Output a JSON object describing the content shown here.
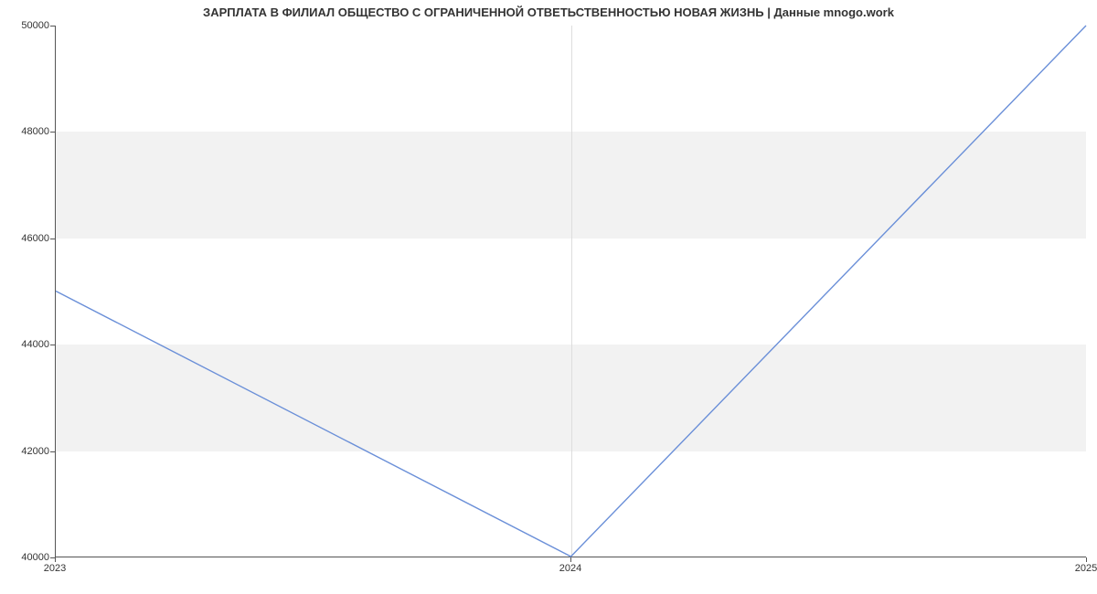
{
  "chart_data": {
    "type": "line",
    "title": "ЗАРПЛАТА В ФИЛИАЛ ОБЩЕСТВО С ОГРАНИЧЕННОЙ ОТВЕТЬСТВЕННОСТЬЮ НОВАЯ ЖИЗНЬ | Данные mnogo.work",
    "xlabel": "",
    "ylabel": "",
    "x_ticks": [
      "2023",
      "2024",
      "2025"
    ],
    "y_ticks": [
      40000,
      42000,
      44000,
      46000,
      48000,
      50000
    ],
    "ylim": [
      40000,
      50000
    ],
    "xlim": [
      2023,
      2025
    ],
    "categories": [
      2023,
      2024,
      2025
    ],
    "values": [
      45000,
      40000,
      50000
    ],
    "line_color": "#6a8fd8",
    "band_color": "#f2f2f2"
  }
}
